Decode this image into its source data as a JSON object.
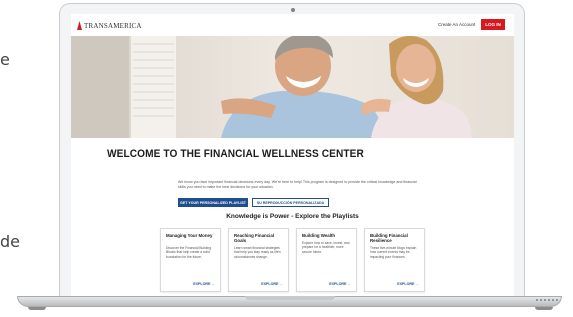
{
  "side": {
    "top_fragment": "e",
    "bottom_fragment": "de"
  },
  "header": {
    "logo": "TRANSAMERICA",
    "create_account": "Create An Account",
    "login": "LOG IN"
  },
  "welcome": {
    "title": "WELCOME TO THE FINANCIAL WELLNESS CENTER",
    "intro": "We know you face important financial decisions every day. We're here to help! This program is designed to provide the critical knowledge and financial skills you need to make the best decisions for your situation.",
    "btn_playlist": "GET YOUR PERSONALIZED PLAYLIST",
    "btn_playlist_es": "SU REPRODUCCIÓN PERSONALIZADA"
  },
  "knowledge_heading": "Knowledge is Power - Explore the Playlists",
  "cards": [
    {
      "title": "Managing Your Money",
      "desc": "Discover the Financial Building Blocks that help create a solid foundation for the future.",
      "explore": "EXPLORE →"
    },
    {
      "title": "Reaching Financial Goals",
      "desc": "Learn smart financial strategies that help you stay ready as life's circumstances change.",
      "explore": "EXPLORE →"
    },
    {
      "title": "Building Wealth",
      "desc": "Explore how to save, invest, and prepare for a healthier, more secure future.",
      "explore": "EXPLORE →"
    },
    {
      "title": "Building Financial Resilience",
      "desc": "These five-minute blogs explain how current events may be impacting your finances.",
      "explore": "EXPLORE →"
    }
  ],
  "colors": {
    "brand_red": "#d71920",
    "brand_blue": "#1f4e8f"
  }
}
